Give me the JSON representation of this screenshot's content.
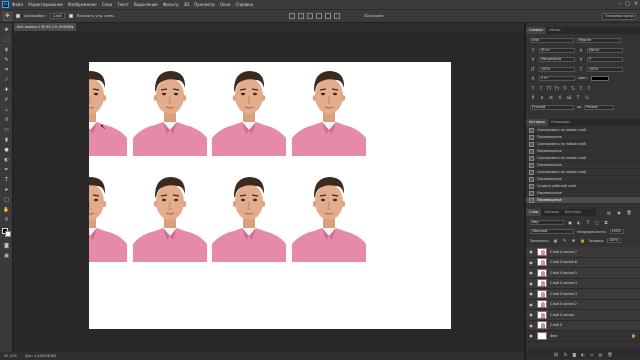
{
  "app": {
    "logo": "Ps"
  },
  "menu": [
    "Файл",
    "Редактирование",
    "Изображение",
    "Слои",
    "Текст",
    "Выделение",
    "Фильтр",
    "3D",
    "Просмотр",
    "Окно",
    "Справка"
  ],
  "window_controls": {
    "minimize": "–",
    "maximize": "□",
    "close": "✕"
  },
  "options": {
    "auto_select_label": "Автовыбор:",
    "auto_select_value": "Слой",
    "show_controls_label": "Показать упр. элем.",
    "mode_3d_label": "3D-режим:",
    "workspace": "Основная среда"
  },
  "document_tab": {
    "title": "Без имени-1 @ 62,1% (RGB/8)",
    "close": "×"
  },
  "status": {
    "zoom": "62,15%",
    "doc_info": "Док: 4,49M/38,8M"
  },
  "panels": {
    "char_tabs": [
      "Символ",
      "Абзац"
    ],
    "character": {
      "font": "Arial",
      "style": "Regular",
      "size": "30 пт",
      "leading": "(Авто)",
      "kerning": "Метрически",
      "tracking": "0",
      "v_scale": "100%",
      "h_scale": "100%",
      "baseline": "0 пт",
      "color_label": "Цвет:",
      "lang": "Русский",
      "aa_label": "aa",
      "aa_value": "Резкое"
    },
    "history_tabs": [
      "История",
      "Операции"
    ],
    "history": [
      "Скопировать на новый слой",
      "Перемещение",
      "Скопировать на новый слой",
      "Перемещение",
      "Скопировать на новый слой",
      "Перемещение",
      "Скопировать на новый слой",
      "Перемещение",
      "Создать рабочий слой",
      "Перемещение",
      "Перемещение"
    ],
    "layers_tabs": [
      "Слои",
      "Каналы",
      "Контуры"
    ],
    "layers_kind": "Вид",
    "blend_mode": "Обычные",
    "opacity_label": "Непрозрачность:",
    "opacity": "100%",
    "lock_label": "Закрепить:",
    "fill_label": "Заливка:",
    "fill": "100%",
    "layers": [
      "Слой 0 копия 7",
      "Слой 0 копия 6",
      "Слой 0 копия 5",
      "Слой 0 копия 4",
      "Слой 0 копия 3",
      "Слой 0 копия 2",
      "Слой 0 копия",
      "Слой 0",
      "Фон"
    ]
  }
}
